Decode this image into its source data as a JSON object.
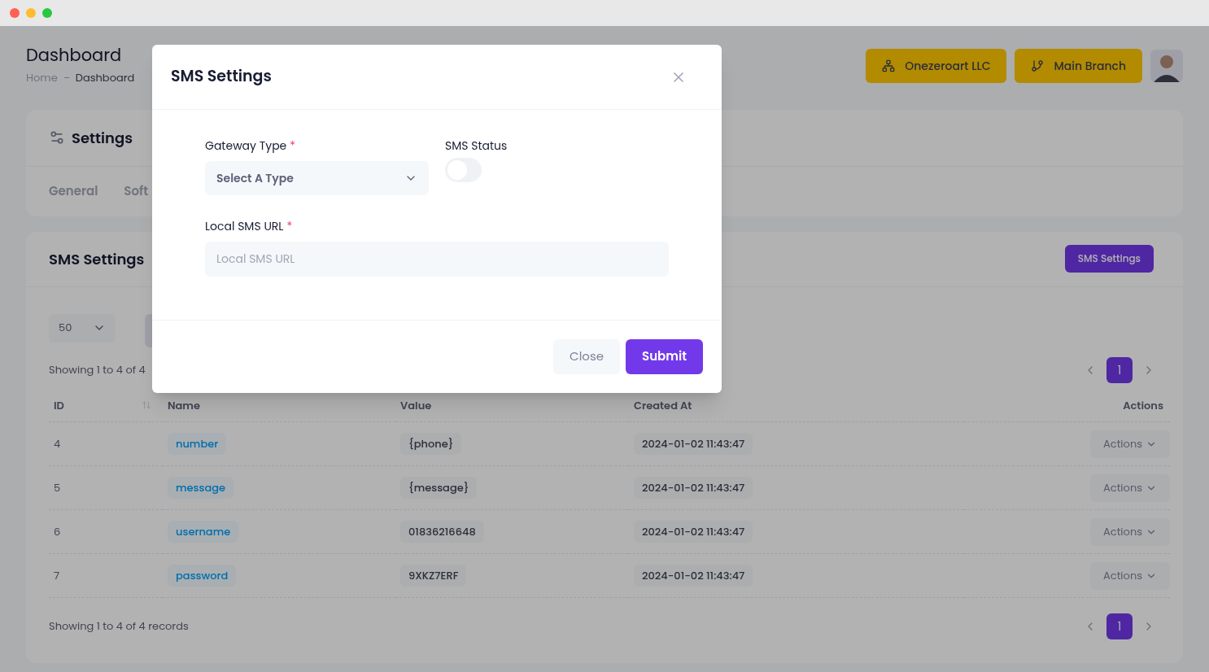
{
  "header": {
    "title": "Dashboard",
    "breadcrumb": [
      "Home",
      "Dashboard"
    ],
    "company_button": "Onezeroart LLC",
    "branch_button": "Main Branch"
  },
  "settings_card": {
    "title": "Settings",
    "tabs": [
      "General",
      "Soft"
    ]
  },
  "sms_card": {
    "title": "SMS Settings",
    "button": "SMS Settings",
    "page_size": "50",
    "summary_top": "Showing 1 to 4 of 4",
    "summary_bottom": "Showing 1 to 4 of 4 records",
    "pagination_top": [
      {
        "label": "1",
        "selected": true
      }
    ],
    "pagination_bottom": [
      {
        "label": "1",
        "selected": true
      }
    ],
    "columns": [
      "ID",
      "Name",
      "Value",
      "Created At",
      "Actions"
    ],
    "rows": [
      {
        "id": "4",
        "name": "number",
        "value": "{phone}",
        "created": "2024-01-02 11:43:47",
        "action": "Actions"
      },
      {
        "id": "5",
        "name": "message",
        "value": "{message}",
        "created": "2024-01-02 11:43:47",
        "action": "Actions"
      },
      {
        "id": "6",
        "name": "username",
        "value": "01836216648",
        "created": "2024-01-02 11:43:47",
        "action": "Actions"
      },
      {
        "id": "7",
        "name": "password",
        "value": "9XKZ7ERF",
        "created": "2024-01-02 11:43:47",
        "action": "Actions"
      }
    ]
  },
  "modal": {
    "title": "SMS Settings",
    "gateway": {
      "label": "Gateway Type",
      "required_mark": "*",
      "value": "Select A Type"
    },
    "status": {
      "label": "SMS Status",
      "on": false
    },
    "url": {
      "label": "Local SMS URL",
      "required_mark": "*",
      "placeholder": "Local SMS URL"
    },
    "buttons": {
      "close": "Close",
      "submit": "Submit"
    }
  }
}
